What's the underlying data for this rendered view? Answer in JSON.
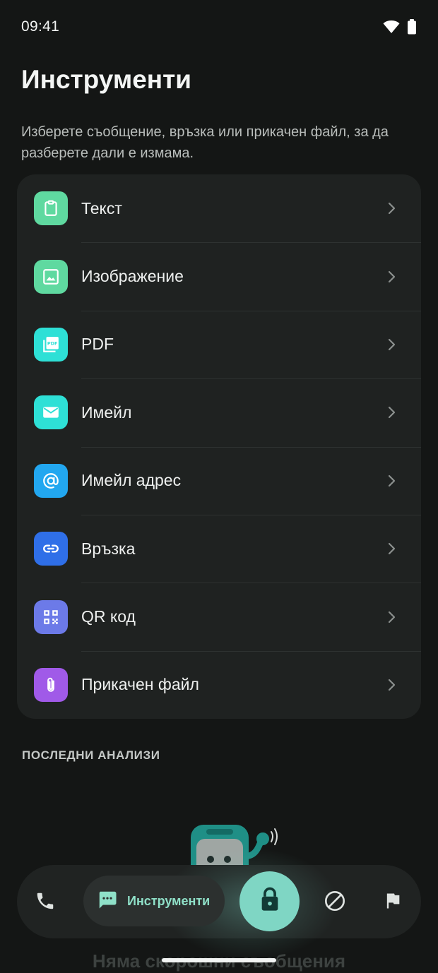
{
  "status_bar": {
    "time": "09:41",
    "icons": [
      "wifi-icon",
      "battery-icon"
    ]
  },
  "header": {
    "title": "Инструменти",
    "subtitle": "Изберете съобщение, връзка или прикачен файл, за да разберете дали е измама."
  },
  "tools": [
    {
      "label": "Текст",
      "icon": "clipboard-icon",
      "color": "#5fd9a0"
    },
    {
      "label": "Изображение",
      "icon": "image-icon",
      "color": "#5fd9a0"
    },
    {
      "label": "PDF",
      "icon": "pdf-icon",
      "color": "#2ee0d6"
    },
    {
      "label": "Имейл",
      "icon": "mail-icon",
      "color": "#2ee0d6"
    },
    {
      "label": "Имейл адрес",
      "icon": "at-sign-icon",
      "color": "#22a7f0"
    },
    {
      "label": "Връзка",
      "icon": "link-icon",
      "color": "#2f6fe8"
    },
    {
      "label": "QR код",
      "icon": "qr-code-icon",
      "color": "#6c7ae8"
    },
    {
      "label": "Прикачен файл",
      "icon": "paperclip-icon",
      "color": "#a05ae8"
    }
  ],
  "recent": {
    "heading": "ПОСЛЕДНИ АНАЛИЗИ",
    "empty_text": "Няма скорошни съобщения"
  },
  "bottom_nav": {
    "active_label": "Инструменти",
    "items": [
      "phone-icon",
      "chat-icon",
      "lock-icon",
      "block-icon",
      "flag-icon"
    ],
    "accent": "#7fd6c4"
  }
}
